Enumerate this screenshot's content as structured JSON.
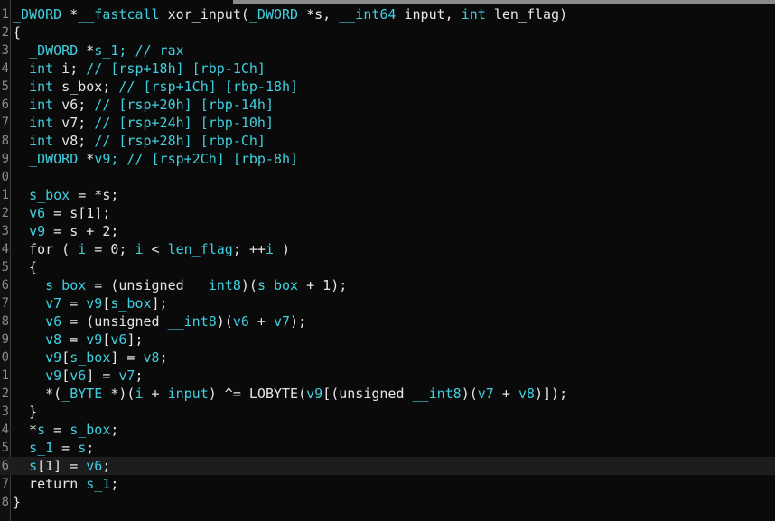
{
  "editor": {
    "current_line_index": 25,
    "lines": [
      {
        "n": "1",
        "tokens": [
          [
            "t-type",
            "_DWORD"
          ],
          [
            "t-op",
            " *"
          ],
          [
            "t-kw",
            "__fastcall"
          ],
          [
            "t-op",
            " "
          ],
          [
            "t-fn",
            "xor_input"
          ],
          [
            "t-op",
            "("
          ],
          [
            "t-type",
            "_DWORD"
          ],
          [
            "t-op",
            " *s, "
          ],
          [
            "t-type",
            "__int64"
          ],
          [
            "t-op",
            " input, "
          ],
          [
            "t-type",
            "int"
          ],
          [
            "t-op",
            " len_flag)"
          ]
        ]
      },
      {
        "n": "2",
        "tokens": [
          [
            "t-op",
            "{"
          ]
        ]
      },
      {
        "n": "3",
        "tokens": [
          [
            "t-op",
            "  "
          ],
          [
            "t-type",
            "_DWORD"
          ],
          [
            "t-op",
            " *"
          ],
          [
            "t-cmt",
            "s_1; // rax"
          ]
        ]
      },
      {
        "n": "4",
        "tokens": [
          [
            "t-op",
            "  "
          ],
          [
            "t-type",
            "int"
          ],
          [
            "t-op",
            " i; "
          ],
          [
            "t-cmt",
            "// [rsp+18h] [rbp-1Ch]"
          ]
        ]
      },
      {
        "n": "5",
        "tokens": [
          [
            "t-op",
            "  "
          ],
          [
            "t-type",
            "int"
          ],
          [
            "t-op",
            " s_box; "
          ],
          [
            "t-cmt",
            "// [rsp+1Ch] [rbp-18h]"
          ]
        ]
      },
      {
        "n": "6",
        "tokens": [
          [
            "t-op",
            "  "
          ],
          [
            "t-type",
            "int"
          ],
          [
            "t-op",
            " v6; "
          ],
          [
            "t-cmt",
            "// [rsp+20h] [rbp-14h]"
          ]
        ]
      },
      {
        "n": "7",
        "tokens": [
          [
            "t-op",
            "  "
          ],
          [
            "t-type",
            "int"
          ],
          [
            "t-op",
            " v7; "
          ],
          [
            "t-cmt",
            "// [rsp+24h] [rbp-10h]"
          ]
        ]
      },
      {
        "n": "8",
        "tokens": [
          [
            "t-op",
            "  "
          ],
          [
            "t-type",
            "int"
          ],
          [
            "t-op",
            " v8; "
          ],
          [
            "t-cmt",
            "// [rsp+28h] [rbp-Ch]"
          ]
        ]
      },
      {
        "n": "9",
        "tokens": [
          [
            "t-op",
            "  "
          ],
          [
            "t-type",
            "_DWORD"
          ],
          [
            "t-op",
            " *"
          ],
          [
            "t-cmt",
            "v9; // [rsp+2Ch] [rbp-8h]"
          ]
        ]
      },
      {
        "n": "0",
        "tokens": [
          [
            "t-op",
            ""
          ]
        ]
      },
      {
        "n": "1",
        "tokens": [
          [
            "t-op",
            "  "
          ],
          [
            "t-kw",
            "s_box"
          ],
          [
            "t-op",
            " = *s;"
          ]
        ]
      },
      {
        "n": "2",
        "tokens": [
          [
            "t-op",
            "  "
          ],
          [
            "t-kw",
            "v6"
          ],
          [
            "t-op",
            " = s[1];"
          ]
        ]
      },
      {
        "n": "3",
        "tokens": [
          [
            "t-op",
            "  "
          ],
          [
            "t-kw",
            "v9"
          ],
          [
            "t-op",
            " = s + 2;"
          ]
        ]
      },
      {
        "n": "4",
        "tokens": [
          [
            "t-op",
            "  for ( "
          ],
          [
            "t-kw",
            "i"
          ],
          [
            "t-op",
            " = 0; "
          ],
          [
            "t-kw",
            "i"
          ],
          [
            "t-op",
            " < "
          ],
          [
            "t-kw",
            "len_flag"
          ],
          [
            "t-op",
            "; ++"
          ],
          [
            "t-kw",
            "i"
          ],
          [
            "t-op",
            " )"
          ]
        ]
      },
      {
        "n": "5",
        "tokens": [
          [
            "t-op",
            "  {"
          ]
        ]
      },
      {
        "n": "6",
        "tokens": [
          [
            "t-op",
            "    "
          ],
          [
            "t-kw",
            "s_box"
          ],
          [
            "t-op",
            " = (unsigned "
          ],
          [
            "t-type",
            "__int8"
          ],
          [
            "t-op",
            ")("
          ],
          [
            "t-kw",
            "s_box"
          ],
          [
            "t-op",
            " + 1);"
          ]
        ]
      },
      {
        "n": "7",
        "tokens": [
          [
            "t-op",
            "    "
          ],
          [
            "t-kw",
            "v7"
          ],
          [
            "t-op",
            " = "
          ],
          [
            "t-kw",
            "v9"
          ],
          [
            "t-op",
            "["
          ],
          [
            "t-kw",
            "s_box"
          ],
          [
            "t-op",
            "];"
          ]
        ]
      },
      {
        "n": "8",
        "tokens": [
          [
            "t-op",
            "    "
          ],
          [
            "t-kw",
            "v6"
          ],
          [
            "t-op",
            " = (unsigned "
          ],
          [
            "t-type",
            "__int8"
          ],
          [
            "t-op",
            ")("
          ],
          [
            "t-kw",
            "v6"
          ],
          [
            "t-op",
            " + "
          ],
          [
            "t-kw",
            "v7"
          ],
          [
            "t-op",
            ");"
          ]
        ]
      },
      {
        "n": "9",
        "tokens": [
          [
            "t-op",
            "    "
          ],
          [
            "t-kw",
            "v8"
          ],
          [
            "t-op",
            " = "
          ],
          [
            "t-kw",
            "v9"
          ],
          [
            "t-op",
            "["
          ],
          [
            "t-kw",
            "v6"
          ],
          [
            "t-op",
            "];"
          ]
        ]
      },
      {
        "n": "0",
        "tokens": [
          [
            "t-op",
            "    "
          ],
          [
            "t-kw",
            "v9"
          ],
          [
            "t-op",
            "["
          ],
          [
            "t-kw",
            "s_box"
          ],
          [
            "t-op",
            "] = "
          ],
          [
            "t-kw",
            "v8"
          ],
          [
            "t-op",
            ";"
          ]
        ]
      },
      {
        "n": "1",
        "tokens": [
          [
            "t-op",
            "    "
          ],
          [
            "t-kw",
            "v9"
          ],
          [
            "t-op",
            "["
          ],
          [
            "t-kw",
            "v6"
          ],
          [
            "t-op",
            "] = "
          ],
          [
            "t-kw",
            "v7"
          ],
          [
            "t-op",
            ";"
          ]
        ]
      },
      {
        "n": "2",
        "tokens": [
          [
            "t-op",
            "    *("
          ],
          [
            "t-type",
            "_BYTE"
          ],
          [
            "t-op",
            " *)("
          ],
          [
            "t-kw",
            "i"
          ],
          [
            "t-op",
            " + "
          ],
          [
            "t-kw",
            "input"
          ],
          [
            "t-op",
            ") ^= LOBYTE("
          ],
          [
            "t-kw",
            "v9"
          ],
          [
            "t-op",
            "[(unsigned "
          ],
          [
            "t-type",
            "__int8"
          ],
          [
            "t-op",
            ")("
          ],
          [
            "t-kw",
            "v7"
          ],
          [
            "t-op",
            " + "
          ],
          [
            "t-kw",
            "v8"
          ],
          [
            "t-op",
            ")]);"
          ]
        ]
      },
      {
        "n": "3",
        "tokens": [
          [
            "t-op",
            "  }"
          ]
        ]
      },
      {
        "n": "4",
        "tokens": [
          [
            "t-op",
            "  *"
          ],
          [
            "t-kw",
            "s"
          ],
          [
            "t-op",
            " = "
          ],
          [
            "t-kw",
            "s_box"
          ],
          [
            "t-op",
            ";"
          ]
        ]
      },
      {
        "n": "5",
        "tokens": [
          [
            "t-op",
            "  "
          ],
          [
            "t-kw",
            "s_1"
          ],
          [
            "t-op",
            " = "
          ],
          [
            "t-kw",
            "s"
          ],
          [
            "t-op",
            ";"
          ]
        ]
      },
      {
        "n": "6",
        "tokens": [
          [
            "t-op",
            "  "
          ],
          [
            "t-kw",
            "s"
          ],
          [
            "t-op",
            "[1] = "
          ],
          [
            "t-kw",
            "v6"
          ],
          [
            "t-op",
            ";"
          ]
        ]
      },
      {
        "n": "7",
        "tokens": [
          [
            "t-op",
            "  return "
          ],
          [
            "t-kw",
            "s_1"
          ],
          [
            "t-op",
            ";"
          ]
        ]
      },
      {
        "n": "8",
        "tokens": [
          [
            "t-op",
            "}"
          ]
        ]
      }
    ]
  }
}
